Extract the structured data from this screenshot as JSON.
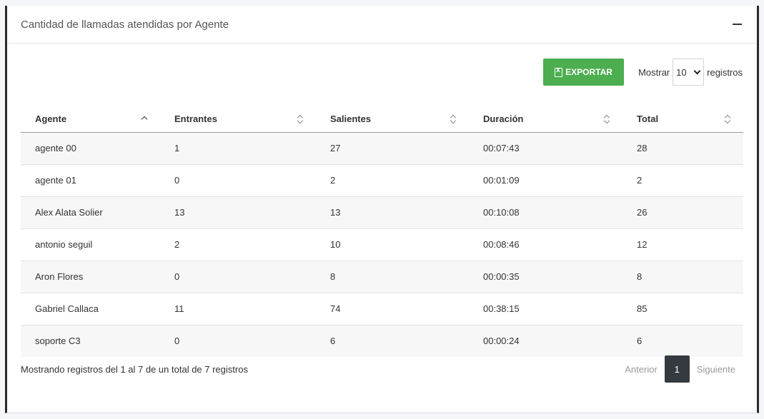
{
  "card": {
    "title": "Cantidad de llamadas atendidas por Agente"
  },
  "toolbar": {
    "export_label": "EXPORTAR",
    "show_label": "Mostrar",
    "show_value": "10",
    "records_label": "registros"
  },
  "table": {
    "headers": [
      "Agente",
      "Entrantes",
      "Salientes",
      "Duración",
      "Total"
    ],
    "rows": [
      [
        "agente 00",
        "1",
        "27",
        "00:07:43",
        "28"
      ],
      [
        "agente 01",
        "0",
        "2",
        "00:01:09",
        "2"
      ],
      [
        "Alex Alata Solier",
        "13",
        "13",
        "00:10:08",
        "26"
      ],
      [
        "antonio seguil",
        "2",
        "10",
        "00:08:46",
        "12"
      ],
      [
        "Aron Flores",
        "0",
        "8",
        "00:00:35",
        "8"
      ],
      [
        "Gabriel Callaca",
        "11",
        "74",
        "00:38:15",
        "85"
      ],
      [
        "soporte C3",
        "0",
        "6",
        "00:00:24",
        "6"
      ]
    ]
  },
  "footer": {
    "info": "Mostrando registros del 1 al 7 de un total de 7 registros",
    "prev_label": "Anterior",
    "page": "1",
    "next_label": "Siguiente"
  },
  "colors": {
    "export": "#4cae4f",
    "active_page": "#343a40"
  }
}
